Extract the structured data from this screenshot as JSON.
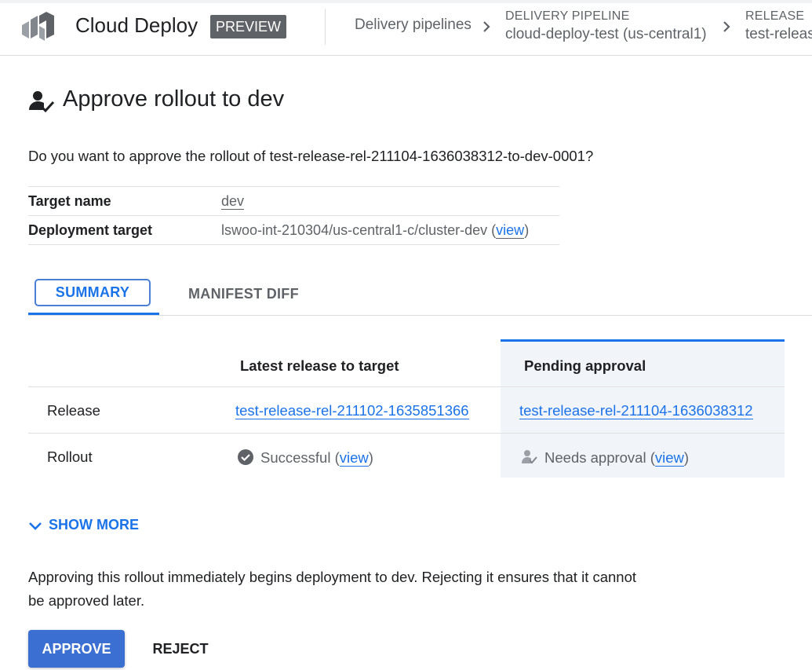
{
  "header": {
    "product_name": "Cloud Deploy",
    "badge": "PREVIEW",
    "breadcrumb": {
      "pipelines_link": "Delivery pipelines",
      "pipeline_caption": "DELIVERY PIPELINE",
      "pipeline_value": "cloud-deploy-test (us-central1)",
      "release_caption": "RELEASE",
      "release_value": "test-releas"
    }
  },
  "page": {
    "title": "Approve rollout to dev",
    "question": "Do you want to approve the rollout of test-release-rel-211104-1636038312-to-dev-0001?",
    "details": {
      "target_name_label": "Target name",
      "target_name_value": "dev",
      "deployment_target_label": "Deployment target",
      "deployment_target_value": "lswoo-int-210304/us-central1-c/cluster-dev",
      "view_open": "(",
      "view_link": "view",
      "view_close": ")"
    }
  },
  "tabs": {
    "summary": "SUMMARY",
    "manifest_diff": "MANIFEST DIFF"
  },
  "comparison": {
    "col_latest": "Latest release to target",
    "col_pending": "Pending approval",
    "rows": {
      "release_label": "Release",
      "release_latest": "test-release-rel-211102-1635851366",
      "release_pending": "test-release-rel-211104-1636038312",
      "rollout_label": "Rollout",
      "rollout_latest_status": "Successful",
      "rollout_pending_status": "Needs approval",
      "view_open": "(",
      "view_link": "view",
      "view_close": ")"
    }
  },
  "show_more": "SHOW MORE",
  "note": "Approving this rollout immediately begins deployment to dev. Rejecting it ensures that it cannot be approved later.",
  "actions": {
    "approve": "APPROVE",
    "reject": "REJECT"
  },
  "icons": {
    "logo": "cloud-deploy-logo-icon",
    "title": "person-check-icon",
    "success": "check-circle-icon",
    "pending": "person-check-icon",
    "breadcrumb_sep": "chevron-right-icon",
    "show_more": "chevron-down-icon"
  },
  "colors": {
    "accent": "#1a73e8",
    "approve_button": "#3b6fd1",
    "badge_bg": "#5f6368",
    "pending_column_bg": "#f1f4f9"
  }
}
